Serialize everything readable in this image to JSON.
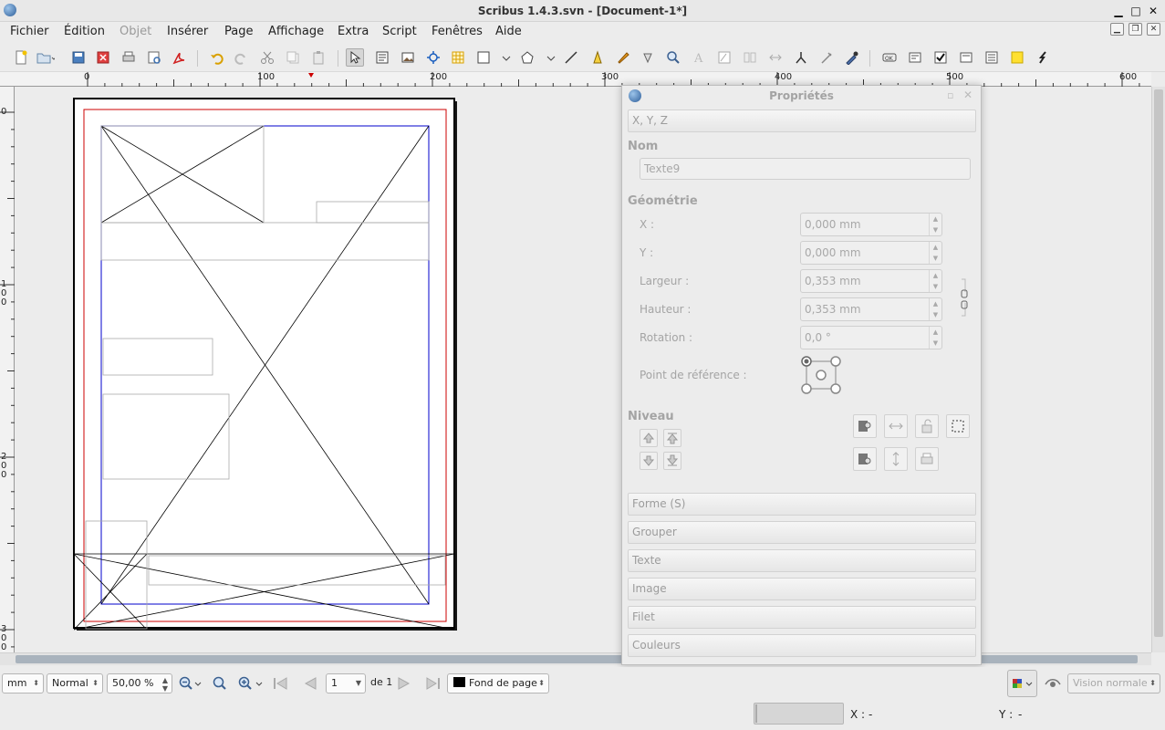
{
  "window": {
    "title": "Scribus 1.4.3.svn - [Document-1*]"
  },
  "menubar": {
    "items": [
      {
        "label": "Fichier",
        "disabled": false
      },
      {
        "label": "Édition",
        "disabled": false
      },
      {
        "label": "Objet",
        "disabled": true
      },
      {
        "label": "Insérer",
        "disabled": false
      },
      {
        "label": "Page",
        "disabled": false
      },
      {
        "label": "Affichage",
        "disabled": false
      },
      {
        "label": "Extra",
        "disabled": false
      },
      {
        "label": "Script",
        "disabled": false
      },
      {
        "label": "Fenêtres",
        "disabled": false
      },
      {
        "label": "Aide",
        "disabled": false
      }
    ]
  },
  "toolbar": {
    "icons": [
      "new-document-icon",
      "open-document-icon",
      "save-icon",
      "close-document-icon",
      "print-icon",
      "preflight-icon",
      "export-pdf-icon",
      "undo-icon",
      "redo-icon",
      "cut-icon",
      "copy-icon",
      "paste-icon",
      "select-icon",
      "text-frame-icon",
      "image-frame-icon",
      "render-frame-icon",
      "table-icon",
      "shape-icon",
      "polygon-icon",
      "line-icon",
      "bezier-icon",
      "freehand-icon",
      "rotate-icon",
      "zoom-icon",
      "edit-contents-icon",
      "edit-text-icon",
      "link-frames-icon",
      "unlink-frames-icon",
      "measure-icon",
      "copy-properties-icon",
      "eyedropper-icon",
      "pdf-button-icon",
      "pdf-text-field-icon",
      "pdf-checkbox-icon",
      "pdf-combobox-icon",
      "pdf-listbox-icon",
      "pdf-annotation-icon",
      "pdf-link-icon"
    ]
  },
  "ruler": {
    "h_labels": [
      "0",
      "100",
      "200",
      "300",
      "400",
      "500",
      "600"
    ],
    "v_labels": [
      "0",
      "1 0 0",
      "2 0 0",
      "3 0 0"
    ]
  },
  "properties": {
    "title": "Propriétés",
    "tab_xyz": "X, Y, Z",
    "name_heading": "Nom",
    "name_value": "Texte9",
    "geometry_heading": "Géométrie",
    "x_label": "X :",
    "x_value": "0,000 mm",
    "y_label": "Y :",
    "y_value": "0,000 mm",
    "width_label": "Largeur :",
    "width_value": "0,353 mm",
    "height_label": "Hauteur :",
    "height_value": "0,353 mm",
    "rotation_label": "Rotation :",
    "rotation_value": "0,0 °",
    "refpoint_label": "Point de référence :",
    "level_heading": "Niveau",
    "sections": [
      "Forme (S)",
      "Grouper",
      "Texte",
      "Image",
      "Filet",
      "Couleurs"
    ]
  },
  "bottombar": {
    "unit": "mm",
    "mode": "Normal",
    "zoom": "50,00 %",
    "page_number": "1",
    "page_of": "de 1",
    "layer": "Fond de page",
    "view": "Vision normale"
  },
  "status": {
    "x_label": "X :",
    "x_value": "-",
    "y_label": "Y :",
    "y_value": "-"
  },
  "colors": {
    "margin_guide": "#cc0000",
    "frame_guide": "#0000cc"
  }
}
